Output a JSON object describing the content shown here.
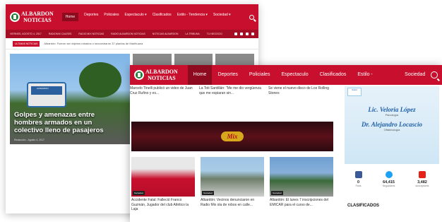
{
  "back": {
    "logo_line1": "ALBARDON",
    "logo_line2": "NOTICIAS",
    "nav": [
      "Home",
      "Deportes",
      "Policiales",
      "Espectaculo ▾",
      "Clasificados",
      "Estilo - Tendencia ▾",
      "Sociedad ▾"
    ],
    "sub": [
      "VIERNES, AGOSTO 4, 2017",
      "RADIOMIX CAUSES",
      "RADIO MIX NOTICIAS",
      "RADIO ALBARDON NOTICIAS",
      "NOTICIAS ALBARDON",
      "LA TRIBUNA",
      "TU NEGOCIO"
    ],
    "ticker_tag": "ULTIMAS NOTICIAS",
    "ticker_text": "Albardón: Fueron ser objetos robados o secuestraron 37 plantas de Marihuana",
    "bus_sign": "ALBARDON",
    "main_title": "Golpes y amenazas entre hombres armados en un colectivo lleno de pasajeros",
    "main_meta": "Redacción - Agosto 4, 2017"
  },
  "front": {
    "logo_line1": "ALBARDON",
    "logo_line2": "NOTICIAS",
    "nav": [
      "Home",
      "Deportes",
      "Policiales",
      "Espectaculo",
      "Clasificados",
      "Estilo - Tendencia",
      "Sociedad"
    ],
    "row1": [
      "Marcelo Tinelli publicó un video de Juan Cruz Rufino y es...",
      "La Toti Santillán: \"Me me dio vergüenza que me espiaran sin...",
      "Se viene el nuevo disco de Los Rolling Stones"
    ],
    "banner_logo": "Mix",
    "cards": [
      {
        "cat": "Sociedad",
        "caption": "Accidente Fatal: Falleció Franco Guzmán, Jugador del club Atlético la Laja"
      },
      {
        "cat": "Sociedad",
        "caption": "Albardón: Vecinos denunciaron en Radio Mix ola de robos en calle..."
      },
      {
        "cat": "Sociedad",
        "caption": "Albardón: El lunes 7 inscripciones del EMICAR para el curso de..."
      }
    ],
    "ad": {
      "logo": "Salud",
      "name1": "Lic. Veloria López",
      "spec1": "Psicología",
      "name2": "Dr. Alejandro Locascio",
      "spec2": "Oftalmología"
    },
    "social": [
      {
        "icon": "facebook-icon",
        "num": "0",
        "label": "Fans"
      },
      {
        "icon": "twitter-icon",
        "num": "64,415",
        "label": "Seguidores"
      },
      {
        "icon": "youtube-icon",
        "num": "3,482",
        "label": "suscriptores"
      }
    ],
    "side_heading": "CLASIFICADOS"
  }
}
